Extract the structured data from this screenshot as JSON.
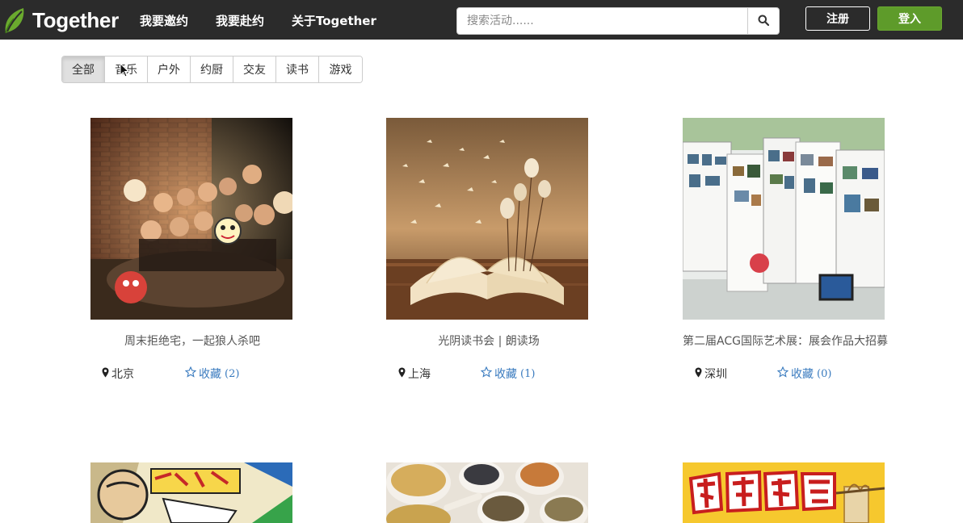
{
  "nav": {
    "brand": "Together",
    "links": [
      "我要邀约",
      "我要赴约",
      "关于Together"
    ],
    "search_placeholder": "搜索活动......",
    "register": "注册",
    "login": "登入"
  },
  "filter": {
    "items": [
      "全部",
      "音乐",
      "户外",
      "约厨",
      "交友",
      "读书",
      "游戏"
    ],
    "active": "全部"
  },
  "cards": [
    {
      "image": "party-group-photo",
      "title": "周末拒绝宅，一起狼人杀吧",
      "location": "北京",
      "fav_label": "收藏",
      "fav_count": "(2)"
    },
    {
      "image": "open-book-photo",
      "title": "光阴读书会 | 朗读场",
      "location": "上海",
      "fav_label": "收藏",
      "fav_count": "(1)"
    },
    {
      "image": "art-exhibition-photo",
      "title": "第二届ACG国际艺术展：展会作品大招募",
      "location": "深圳",
      "fav_label": "收藏",
      "fav_count": "(0)"
    },
    {
      "image": "comic-poster",
      "title": "",
      "location": "",
      "fav_label": "",
      "fav_count": ""
    },
    {
      "image": "spices-photo",
      "title": "",
      "location": "",
      "fav_label": "",
      "fav_count": ""
    },
    {
      "image": "noodle-canteen-poster",
      "title": "",
      "location": "",
      "fav_label": "",
      "fav_count": ""
    }
  ],
  "colors": {
    "navbar": "#2b2b2b",
    "login_button": "#5e9b2a",
    "link_blue": "#3a7bbf"
  }
}
